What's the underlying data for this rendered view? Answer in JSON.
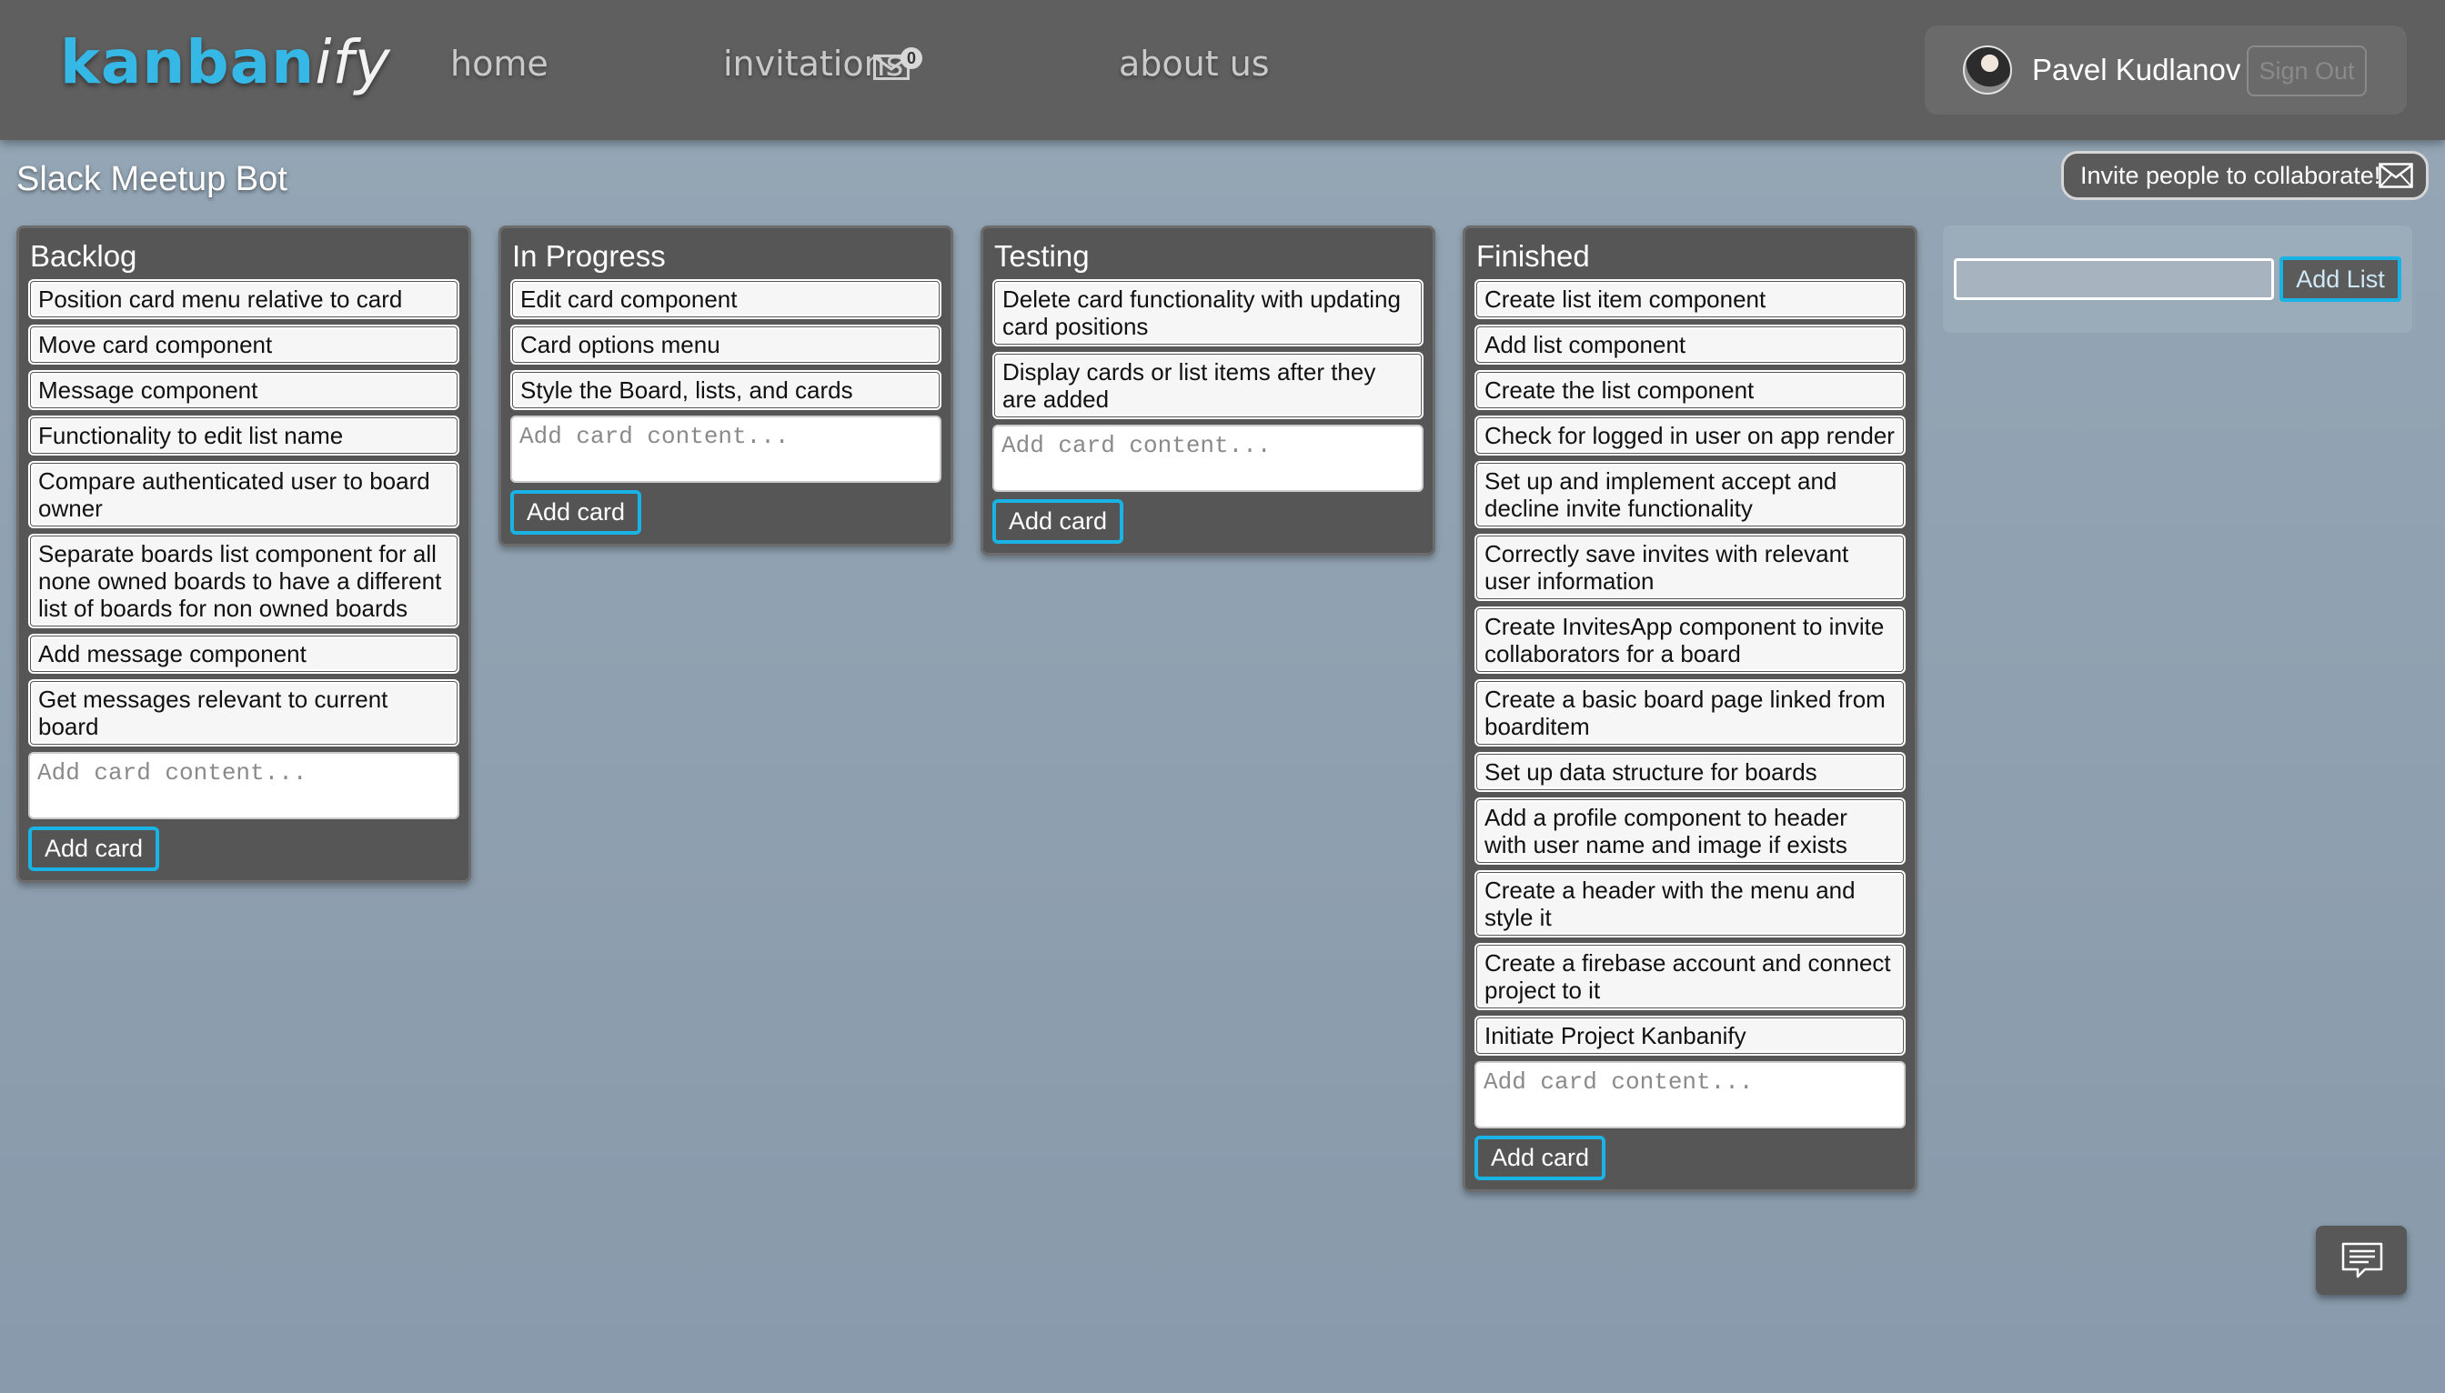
{
  "header": {
    "logo_part1": "kanban",
    "logo_part2": "ify",
    "nav": {
      "home": "home",
      "invitations": "invitations",
      "invitations_count": "0",
      "about": "about us"
    },
    "user_name": "Pavel Kudlanov",
    "sign_out": "Sign Out"
  },
  "board": {
    "title": "Slack Meetup Bot",
    "invite_label": "Invite people to collaborate!"
  },
  "lists": [
    {
      "title": "Backlog",
      "cards": [
        "Position card menu relative to card",
        "Move card component",
        "Message component",
        "Functionality to edit list name",
        "Compare authenticated user to board owner",
        "Separate boards list component for all none owned boards to have a different list of boards for non owned boards",
        "Add message component",
        "Get messages relevant to current board"
      ]
    },
    {
      "title": "In Progress",
      "cards": [
        "Edit card component",
        "Card options menu",
        "Style the Board, lists, and cards"
      ]
    },
    {
      "title": "Testing",
      "cards": [
        "Delete card functionality with updating card positions",
        "Display cards or list items after they are added"
      ]
    },
    {
      "title": "Finished",
      "cards": [
        "Create list item component",
        "Add list component",
        "Create the list component",
        "Check for logged in user on app render",
        "Set up and implement accept and decline invite functionality",
        "Correctly save invites with relevant user information",
        "Create InvitesApp component to invite collaborators for a board",
        "Create a basic board page linked from boarditem",
        "Set up data structure for boards",
        "Add a profile component to header with user name and image if exists",
        "Create a header with the menu and style it",
        "Create a firebase account and connect project to it",
        "Initiate Project Kanbanify"
      ]
    }
  ],
  "card_input_placeholder": "Add card content...",
  "add_card_label": "Add card",
  "add_list": {
    "input_value": "",
    "button_label": "Add List"
  },
  "colors": {
    "accent": "#1ab3e6",
    "header_bg": "#5f5f5f",
    "list_bg": "#565656",
    "card_bg": "#f6f6f6"
  },
  "icons": {
    "invitations": "envelope-icon",
    "invite": "envelope-icon",
    "feedback": "chat-icon"
  }
}
